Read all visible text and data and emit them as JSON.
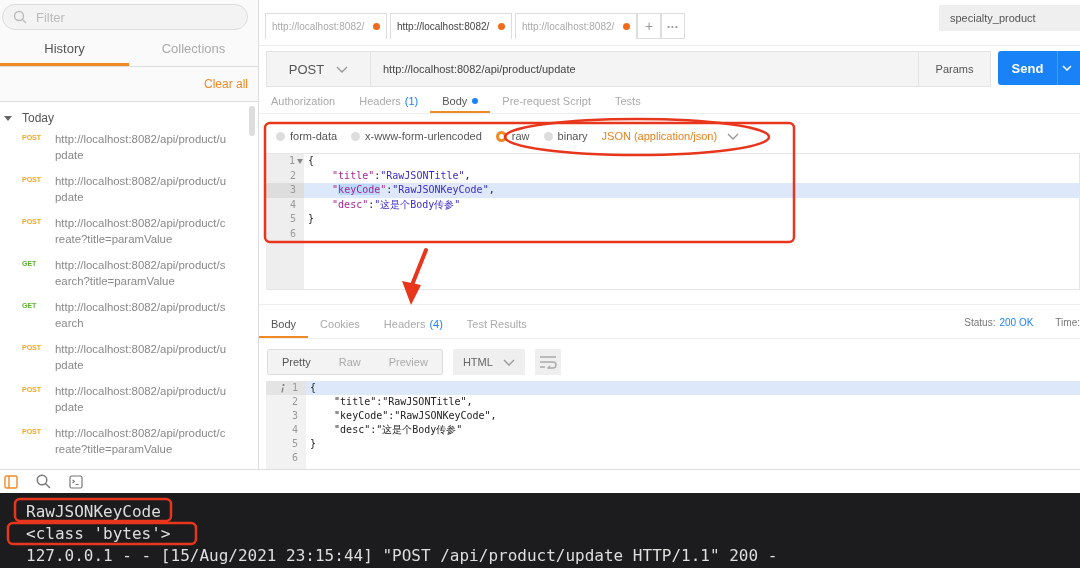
{
  "sidebar": {
    "filter": {
      "placeholder": "Filter"
    },
    "tabs": [
      {
        "label": "History",
        "selected": true
      },
      {
        "label": "Collections",
        "selected": false
      }
    ],
    "clear_all": "Clear all",
    "group": {
      "label": "Today",
      "expanded": true,
      "items": [
        {
          "method": "POST",
          "url": "http://localhost:8082/api/product/update"
        },
        {
          "method": "POST",
          "url": "http://localhost:8082/api/product/update"
        },
        {
          "method": "POST",
          "url": "http://localhost:8082/api/product/create?title=paramValue"
        },
        {
          "method": "GET",
          "url": "http://localhost:8082/api/product/search?title=paramValue"
        },
        {
          "method": "GET",
          "url": "http://localhost:8082/api/product/search"
        },
        {
          "method": "POST",
          "url": "http://localhost:8082/api/product/update"
        },
        {
          "method": "POST",
          "url": "http://localhost:8082/api/product/update"
        },
        {
          "method": "POST",
          "url": "http://localhost:8082/api/product/create?title=paramValue"
        }
      ]
    }
  },
  "request_tabs": [
    {
      "label": "http://localhost:8082/",
      "selected": false,
      "unsaved": true
    },
    {
      "label": "http://localhost:8082/",
      "selected": true,
      "unsaved": true
    },
    {
      "label": "http://localhost:8082/",
      "selected": false,
      "unsaved": true
    }
  ],
  "new_tab": "+",
  "more_tabs": "•••",
  "environment": "specialty_product",
  "request": {
    "method": "POST",
    "url": "http://localhost:8082/api/product/update",
    "params": "Params",
    "send": "Send",
    "tabs": [
      {
        "label": "Authorization",
        "selected": false
      },
      {
        "label": "Headers",
        "count": "(1)",
        "selected": false
      },
      {
        "label": "Body",
        "selected": true,
        "modified": true
      },
      {
        "label": "Pre-request Script",
        "selected": false
      },
      {
        "label": "Tests",
        "selected": false
      }
    ],
    "body_types": [
      {
        "label": "form-data",
        "selected": false
      },
      {
        "label": "x-www-form-urlencoded",
        "selected": false
      },
      {
        "label": "raw",
        "selected": true
      },
      {
        "label": "binary",
        "selected": false
      }
    ],
    "content_type": "JSON (application/json)",
    "editor": [
      {
        "number": "1",
        "fold": true,
        "active": false,
        "tokens": [
          {
            "kind": "punct",
            "text": "{"
          }
        ]
      },
      {
        "number": "2",
        "fold": false,
        "active": false,
        "tokens": [
          {
            "kind": "key",
            "text": "    \"title\""
          },
          {
            "kind": "punct",
            "text": ":"
          },
          {
            "kind": "string",
            "text": "\"RawJSONTitle\""
          },
          {
            "kind": "punct",
            "text": ","
          }
        ]
      },
      {
        "number": "3",
        "fold": false,
        "active": true,
        "tokens": [
          {
            "kind": "key",
            "text": "    \""
          },
          {
            "kind": "selection",
            "text": "keyCode"
          },
          {
            "kind": "key",
            "text": "\""
          },
          {
            "kind": "punct",
            "text": ":"
          },
          {
            "kind": "string",
            "text": "\"RawJSONKeyCode\""
          },
          {
            "kind": "punct",
            "text": ","
          }
        ]
      },
      {
        "number": "4",
        "fold": false,
        "active": false,
        "tokens": [
          {
            "kind": "key",
            "text": "    \"desc\""
          },
          {
            "kind": "punct",
            "text": ":"
          },
          {
            "kind": "string",
            "text": "\"这是个Body传参\""
          }
        ]
      },
      {
        "number": "5",
        "fold": false,
        "active": false,
        "tokens": [
          {
            "kind": "punct",
            "text": "}"
          }
        ]
      },
      {
        "number": "6",
        "fold": false,
        "active": false
      }
    ]
  },
  "response": {
    "tabs": [
      {
        "label": "Body",
        "selected": true
      },
      {
        "label": "Cookies",
        "selected": false
      },
      {
        "label": "Headers",
        "count": "(4)",
        "selected": false
      },
      {
        "label": "Test Results",
        "selected": false
      }
    ],
    "status_label": "Status:",
    "status": "200 OK",
    "time_label": "Time:",
    "views": [
      {
        "label": "Pretty",
        "selected": true
      },
      {
        "label": "Raw",
        "selected": false
      },
      {
        "label": "Preview",
        "selected": false
      }
    ],
    "format": "HTML",
    "editor": [
      {
        "number": "1",
        "info": true,
        "active": true,
        "text": "{"
      },
      {
        "number": "2",
        "info": false,
        "active": false,
        "text": "    \"title\":\"RawJSONTitle\","
      },
      {
        "number": "3",
        "info": false,
        "active": false,
        "text": "    \"keyCode\":\"RawJSONKeyCode\","
      },
      {
        "number": "4",
        "info": false,
        "active": false,
        "text": "    \"desc\":\"这是个Body传参\""
      },
      {
        "number": "5",
        "info": false,
        "active": false,
        "text": "}"
      },
      {
        "number": "6",
        "info": false,
        "active": false
      }
    ]
  },
  "terminal": {
    "lines": [
      "RawJSONKeyCode",
      "<class 'bytes'>",
      "127.0.0.1 - - [15/Aug/2021 23:15:44] \"POST /api/product/update HTTP/1.1\" 200 -"
    ]
  },
  "annotations": [
    {
      "kind": "box",
      "color": "#e8361c"
    },
    {
      "kind": "ellipse",
      "color": "#e8361c"
    },
    {
      "kind": "arrow",
      "color": "#e8361c"
    },
    {
      "kind": "box",
      "color": "#e8361c"
    },
    {
      "kind": "box",
      "color": "#e8361c"
    }
  ]
}
